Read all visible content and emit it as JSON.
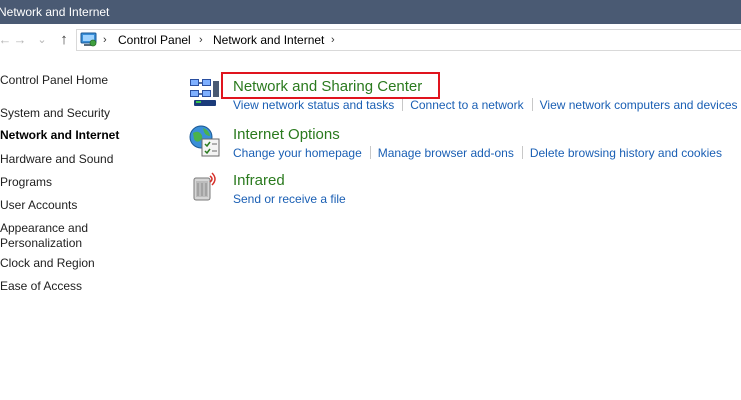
{
  "window": {
    "title": "Network and Internet"
  },
  "nav": {
    "back_glyph": "←",
    "forward_glyph": "→",
    "recent_glyph": "⌄",
    "up_glyph": "↑"
  },
  "address": {
    "icon": "control-panel-icon",
    "separator": "›",
    "breadcrumbs": [
      "Control Panel",
      "Network and Internet"
    ]
  },
  "sidebar": {
    "items": [
      {
        "label": "Control Panel Home"
      },
      {
        "label": "System and Security"
      },
      {
        "label": "Network and Internet",
        "active": true
      },
      {
        "label": "Hardware and Sound"
      },
      {
        "label": "Programs"
      },
      {
        "label": "User Accounts"
      },
      {
        "label": "Appearance and"
      },
      {
        "label": "Personalization"
      },
      {
        "label": "Clock and Region"
      },
      {
        "label": "Ease of Access"
      }
    ]
  },
  "categories": [
    {
      "title": "Network and Sharing Center",
      "icon": "network-sharing-icon",
      "highlighted": true,
      "links": [
        "View network status and tasks",
        "Connect to a network",
        "View network computers and devices"
      ]
    },
    {
      "title": "Internet Options",
      "icon": "internet-options-icon",
      "links": [
        "Change your homepage",
        "Manage browser add-ons",
        "Delete browsing history and cookies"
      ]
    },
    {
      "title": "Infrared",
      "icon": "infrared-icon",
      "links": [
        "Send or receive a file"
      ]
    }
  ],
  "colors": {
    "titlebar": "#4a5a73",
    "category_title": "#2a7a1e",
    "link": "#1a5fb4",
    "highlight": "#e0141e"
  }
}
